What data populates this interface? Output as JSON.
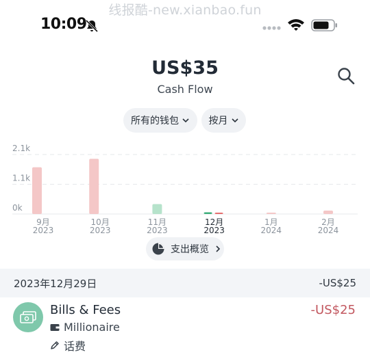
{
  "watermark": "线报酷-new.xianbao.fun",
  "status_bar": {
    "time": "10:09"
  },
  "header": {
    "amount": "US$35",
    "subtitle": "Cash Flow"
  },
  "filters": {
    "wallet": "所有的钱包",
    "period": "按月"
  },
  "chart_data": {
    "type": "bar",
    "title": "",
    "xlabel": "",
    "ylabel": "",
    "y_tick_labels": [
      "2.1k",
      "1.1k",
      "0k"
    ],
    "ylim": [
      0,
      2100
    ],
    "grid": true,
    "legend": "none",
    "categories": [
      {
        "month": "9月",
        "year": "2023"
      },
      {
        "month": "10月",
        "year": "2023"
      },
      {
        "month": "11月",
        "year": "2023"
      },
      {
        "month": "12月",
        "year": "2023"
      },
      {
        "month": "1月",
        "year": "2024"
      },
      {
        "month": "2月",
        "year": "2024"
      }
    ],
    "selected_index": 3,
    "series": [
      {
        "values": [
          1650,
          1950,
          0,
          60,
          0,
          0
        ],
        "color": "#7fd0a8"
      },
      {
        "values": [
          0,
          0,
          350,
          0,
          0,
          0
        ],
        "color": "#f4c7c7"
      }
    ],
    "colors": {
      "expense": "#f4c7c7",
      "expense_selected": "#e66d6d",
      "income": "#b6e3cb",
      "income_selected": "#3cae7a"
    }
  },
  "overview_button": {
    "label": "支出概览"
  },
  "date_group": {
    "date": "2023年12月29日",
    "total": "-US$25"
  },
  "transaction": {
    "title": "Bills & Fees",
    "wallet": "Millionaire",
    "note": "话费",
    "amount": "-US$25",
    "icon": "bills-icon",
    "icon_color": "#7fc8ab",
    "amount_color": "#c2575f"
  }
}
